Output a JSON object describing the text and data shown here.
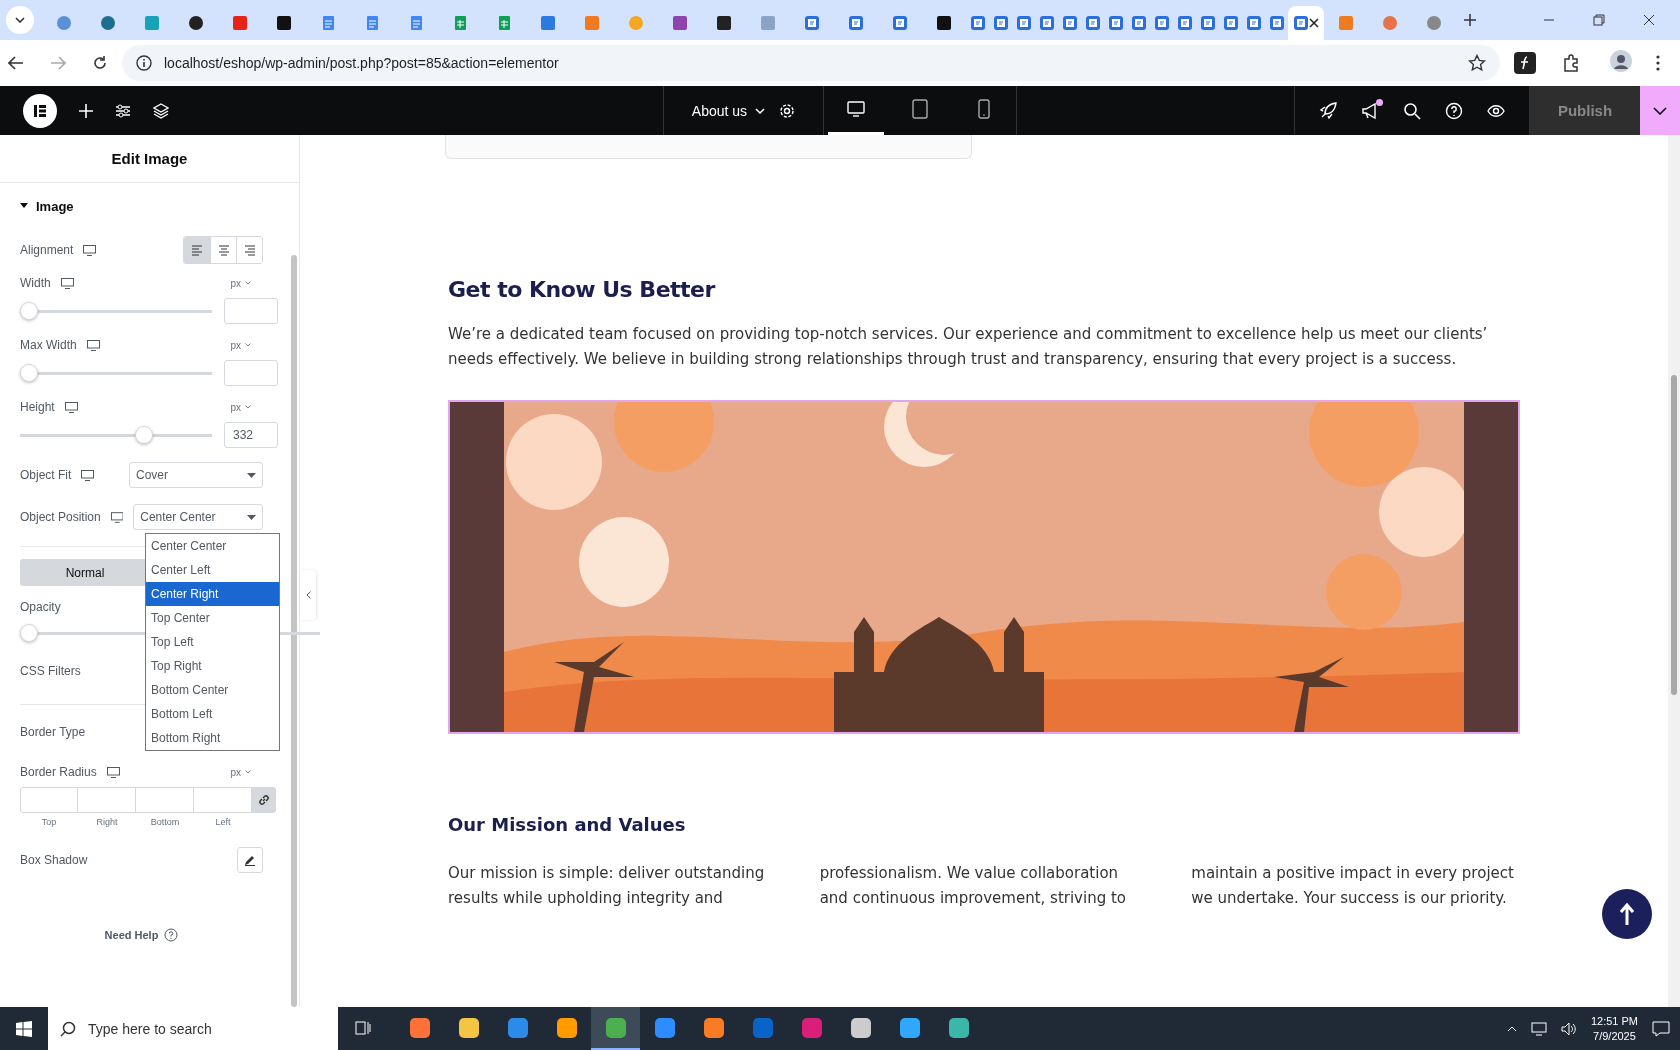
{
  "browser_tabs": [
    {
      "kind": "circle",
      "color": "#5b8fd6",
      "selected": false
    },
    {
      "kind": "circle",
      "color": "#1e6f8f",
      "selected": false
    },
    {
      "kind": "square",
      "color": "#17a2b8",
      "selected": false
    },
    {
      "kind": "circle",
      "color": "#222222",
      "selected": false
    },
    {
      "kind": "square",
      "color": "#e62117",
      "selected": false
    },
    {
      "kind": "square",
      "color": "#111111",
      "selected": false
    },
    {
      "kind": "doc",
      "color": "#4285f4",
      "selected": false
    },
    {
      "kind": "doc",
      "color": "#4285f4",
      "selected": false
    },
    {
      "kind": "doc",
      "color": "#4285f4",
      "selected": false
    },
    {
      "kind": "sheet",
      "color": "#0f9d58",
      "selected": false
    },
    {
      "kind": "sheet",
      "color": "#0f9d58",
      "selected": false
    },
    {
      "kind": "square",
      "color": "#2a7ae2",
      "selected": false
    },
    {
      "kind": "square",
      "color": "#f07a22",
      "selected": false
    },
    {
      "kind": "circle",
      "color": "#f5a623",
      "selected": false
    },
    {
      "kind": "square",
      "color": "#8e44ad",
      "selected": false
    },
    {
      "kind": "square",
      "color": "#222222",
      "selected": false
    },
    {
      "kind": "square",
      "color": "#8aa4c8",
      "selected": false
    },
    {
      "kind": "form",
      "color": "#2a6fdb",
      "selected": false
    },
    {
      "kind": "form",
      "color": "#2a6fdb",
      "selected": false
    },
    {
      "kind": "form",
      "color": "#2a6fdb",
      "selected": false
    },
    {
      "kind": "square",
      "color": "#111111",
      "selected": false
    },
    {
      "kind": "form",
      "color": "#2a6fdb",
      "selected": false
    },
    {
      "kind": "form",
      "color": "#2a6fdb",
      "selected": false
    },
    {
      "kind": "form",
      "color": "#2a6fdb",
      "selected": false
    },
    {
      "kind": "form",
      "color": "#2a6fdb",
      "selected": false
    },
    {
      "kind": "form",
      "color": "#2a6fdb",
      "selected": false
    },
    {
      "kind": "form",
      "color": "#2a6fdb",
      "selected": false
    },
    {
      "kind": "form",
      "color": "#2a6fdb",
      "selected": false
    },
    {
      "kind": "form",
      "color": "#2a6fdb",
      "selected": false
    },
    {
      "kind": "form",
      "color": "#2a6fdb",
      "selected": false
    },
    {
      "kind": "form",
      "color": "#2a6fdb",
      "selected": false
    },
    {
      "kind": "form",
      "color": "#2a6fdb",
      "selected": false
    },
    {
      "kind": "form",
      "color": "#2a6fdb",
      "selected": false
    },
    {
      "kind": "form",
      "color": "#2a6fdb",
      "selected": false
    },
    {
      "kind": "form",
      "color": "#2a6fdb",
      "selected": false
    },
    {
      "kind": "form",
      "color": "#2a6fdb",
      "selected": true
    },
    {
      "kind": "square",
      "color": "#f07a22",
      "selected": false
    },
    {
      "kind": "circle",
      "color": "#e8734a",
      "selected": false
    },
    {
      "kind": "circle",
      "color": "#888888",
      "selected": false
    }
  ],
  "address_bar": {
    "url": "localhost/eshop/wp-admin/post.php?post=85&action=elementor"
  },
  "editor_bar": {
    "page": "About us",
    "devices": [
      {
        "kind": "desktop",
        "selected": true
      },
      {
        "kind": "tablet",
        "selected": false
      },
      {
        "kind": "mobile",
        "selected": false
      }
    ],
    "notification": true,
    "publish": {
      "label": "Publish",
      "disabled": true
    }
  },
  "panel": {
    "title": "Edit Image",
    "section": {
      "label": "Image",
      "expanded": true
    },
    "controls": [
      {
        "kind": "alignment",
        "label": "Alignment",
        "options": [
          {
            "kind": "left",
            "selected": true
          },
          {
            "kind": "center",
            "selected": false
          },
          {
            "kind": "right",
            "selected": false
          }
        ]
      },
      {
        "kind": "slider",
        "label": "Width",
        "unit": "px",
        "level": 0
      },
      {
        "kind": "slider",
        "label": "Max Width",
        "unit": "px",
        "level": 0
      },
      {
        "kind": "slider",
        "label": "Height",
        "unit": "px",
        "level": 0.66,
        "value": "332"
      },
      {
        "kind": "select",
        "label": "Object Fit",
        "value": "Cover"
      },
      {
        "kind": "select",
        "label": "Object Position",
        "value": "Center Center"
      },
      {
        "kind": "divider"
      },
      {
        "kind": "tabs",
        "tabs": [
          {
            "label": "Normal",
            "selected": true
          }
        ]
      },
      {
        "kind": "slider",
        "label": "Opacity",
        "level": 0
      },
      {
        "kind": "label",
        "label": "CSS Filters"
      },
      {
        "kind": "divider"
      },
      {
        "kind": "label",
        "label": "Border Type"
      },
      {
        "kind": "dimensions",
        "label": "Border Radius",
        "unit": "px",
        "fields": [
          "Top",
          "Right",
          "Bottom",
          "Left"
        ]
      },
      {
        "kind": "button",
        "label": "Box Shadow"
      }
    ],
    "dropdown": {
      "options": [
        {
          "label": "Center Center",
          "selected": false
        },
        {
          "label": "Center Left",
          "selected": false
        },
        {
          "label": "Center Right",
          "selected": true
        },
        {
          "label": "Top Center",
          "selected": false
        },
        {
          "label": "Top Left",
          "selected": false
        },
        {
          "label": "Top Right",
          "selected": false
        },
        {
          "label": "Bottom Center",
          "selected": false
        },
        {
          "label": "Bottom Left",
          "selected": false
        },
        {
          "label": "Bottom Right",
          "selected": false
        }
      ]
    },
    "help": "Need Help"
  },
  "canvas": {
    "heading": "Get to Know Us Better",
    "intro": "We’re a dedicated team focused on providing top-notch services. Our experience and commitment to excellence help us meet our clients’ needs effectively. We believe in building strong relationships through trust and transparency, ensuring that every project is a success.",
    "mission_heading": "Our Mission and Values",
    "mission_text": "Our mission is simple: deliver outstanding results while upholding integrity and professionalism. We value collaboration and continuous improvement, striving to maintain a positive impact in every project we undertake. Your success is our priority."
  },
  "taskbar": {
    "search_placeholder": "Type here to search",
    "apps": [
      {
        "color": "#ff7139",
        "selected": false
      },
      {
        "color": "#f4c542",
        "selected": false
      },
      {
        "color": "#2c8ae8",
        "selected": false
      },
      {
        "color": "#ff9a00",
        "selected": false
      },
      {
        "color": "#4caf50",
        "selected": true
      },
      {
        "color": "#2d8cff",
        "selected": false
      },
      {
        "color": "#fb7a24",
        "selected": false
      },
      {
        "color": "#0a64c8",
        "selected": false
      },
      {
        "color": "#da1f7b",
        "selected": false
      },
      {
        "color": "#cccccc",
        "selected": false
      },
      {
        "color": "#31a8ff",
        "selected": false
      },
      {
        "color": "#3ab7a8",
        "selected": false
      }
    ],
    "time": "12:51 PM",
    "date": "7/9/2025"
  }
}
